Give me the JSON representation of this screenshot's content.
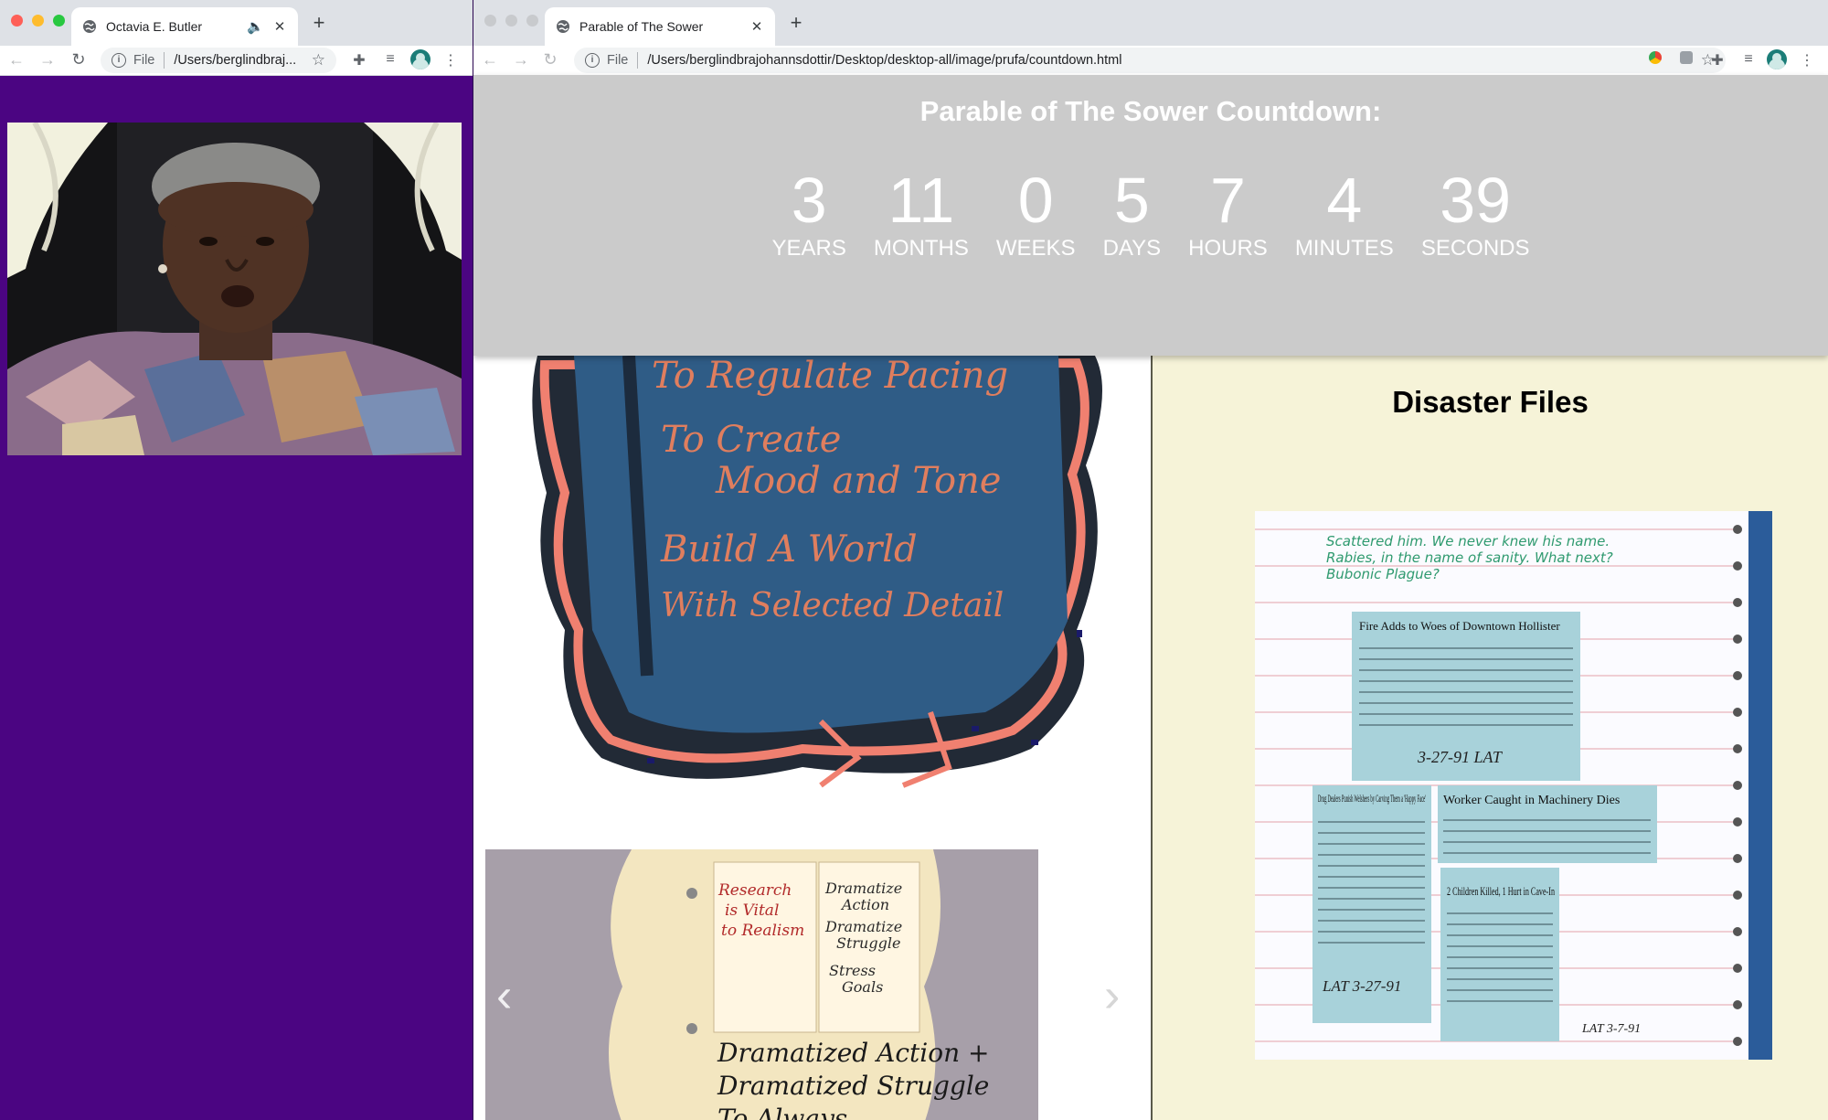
{
  "left_window": {
    "tab_title": "Octavia E. Butler",
    "url_scheme": "File",
    "url": "/Users/berglindbraj...",
    "icons": [
      "globe-icon",
      "speaker-icon",
      "close-icon",
      "plus-icon",
      "back-icon",
      "forward-icon",
      "reload-icon",
      "info-icon",
      "star-icon",
      "extensions-icon",
      "media-icon",
      "profile-icon",
      "menu-icon"
    ],
    "background": "#4b0582"
  },
  "right_window": {
    "tab_title": "Parable of The Sower",
    "url_scheme": "File",
    "url": "/Users/berglindbrajohannsdottir/Desktop/desktop-all/image/prufa/countdown.html",
    "countdown": {
      "title": "Parable of The Sower Countdown:",
      "units": [
        {
          "value": "3",
          "label": "YEARS"
        },
        {
          "value": "11",
          "label": "MONTHS"
        },
        {
          "value": "0",
          "label": "WEEKS"
        },
        {
          "value": "5",
          "label": "DAYS"
        },
        {
          "value": "7",
          "label": "HOURS"
        },
        {
          "value": "4",
          "label": "MINUTES"
        },
        {
          "value": "39",
          "label": "SECONDS"
        }
      ]
    },
    "collage_text": {
      "line1": "To Regulate Pacing",
      "line2": "To Create",
      "line3": "Mood and Tone",
      "line4": "Build A World",
      "line5": "With Selected Detail"
    },
    "carousel_text": {
      "note_left_1": "Research",
      "note_left_2": "is Vital",
      "note_left_3": "to Realism",
      "note_right_1": "Dramatize",
      "note_right_2": "Action",
      "note_right_3": "Dramatize",
      "note_right_4": "Struggle",
      "note_right_5": "Stress",
      "note_right_6": "Goals",
      "big_line_1": "Dramatized Action +",
      "big_line_2": "Dramatized Struggle",
      "big_line_3": "To Always"
    },
    "disaster": {
      "title": "Disaster Files",
      "handwriting": [
        "Scattered him. We never knew his name.",
        "Rabies, in the name of sanity. What next?",
        "Bubonic Plague?"
      ],
      "clip1_headline": "Fire Adds to Woes of Downtown Hollister",
      "clip1_note": "3-27-91   LAT",
      "clip2_headline": "Drug Dealers Punish Welshers by Carving Them a 'Happy Face'",
      "clip2_note": "LAT 3-27-91",
      "clip3_headline": "Worker Caught in Machinery Dies",
      "clip3_note": "LAT 3-7-91",
      "clip4_headline": "2 Children Killed, 1 Hurt in Cave-In"
    }
  }
}
